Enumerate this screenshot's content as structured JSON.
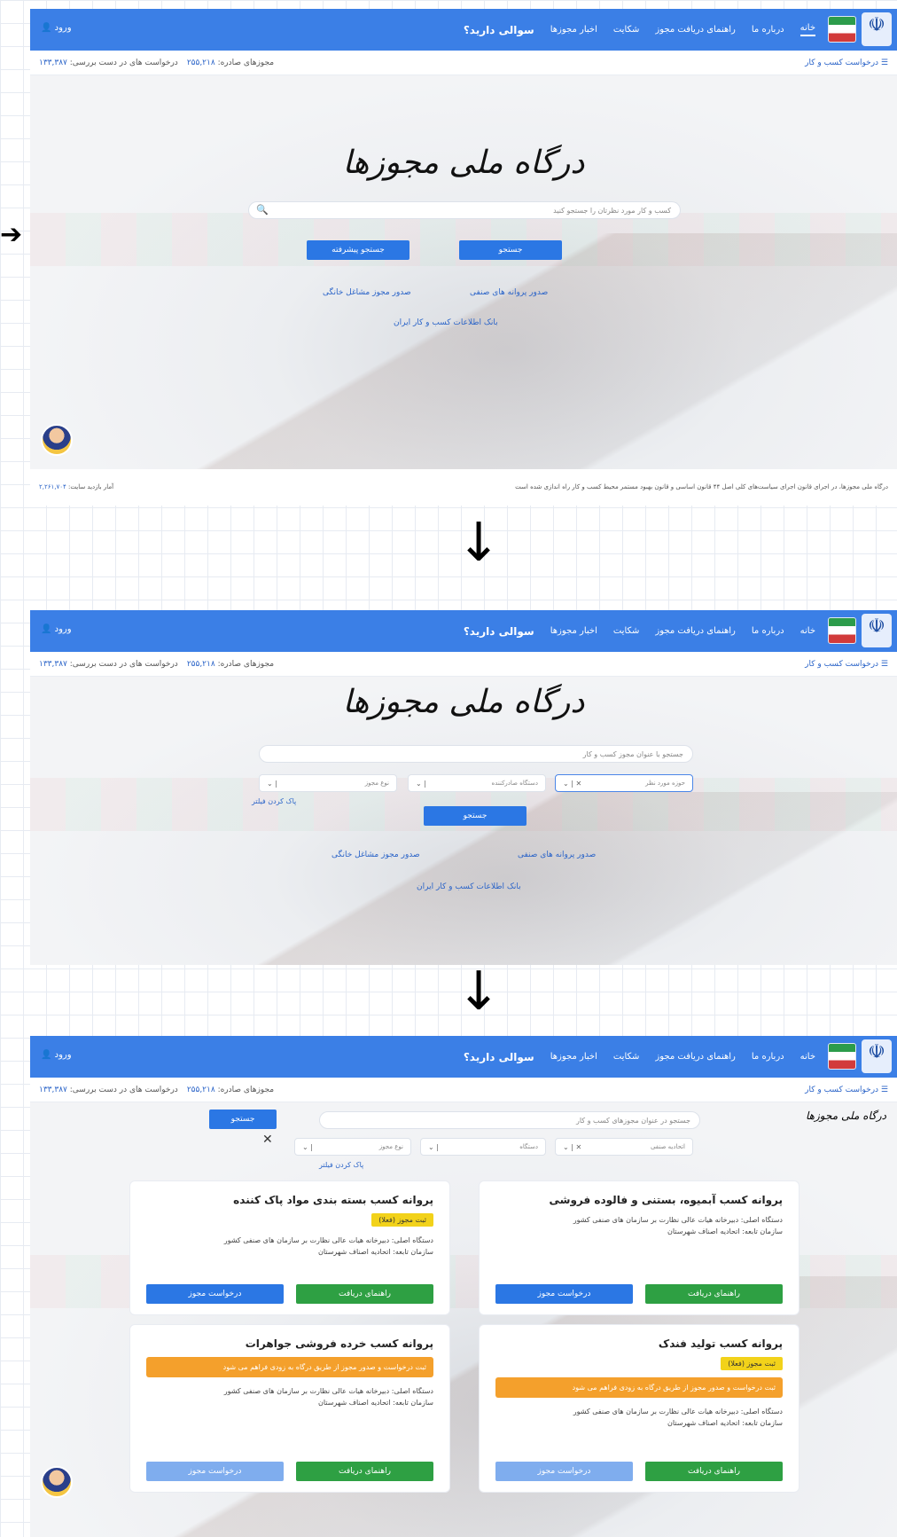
{
  "nav": {
    "login": "ورود",
    "items": [
      "خانه",
      "درباره ما",
      "راهنمای دریافت مجوز",
      "شکایت",
      "اخبار مجوزها",
      "سوالی دارید؟"
    ]
  },
  "sub": {
    "requests": "درخواست کسب و کار",
    "stats_label_requests": "درخواست های در دست بررسی:",
    "stats_value_requests": "۱۳۳,۳۸۷",
    "stats_label_issued": "مجوزهای صادره:",
    "stats_value_issued": "۲۵۵,۲۱۸"
  },
  "hero": {
    "brand": "درگاه ملی مجوزها",
    "search_placeholder": "کسب و کار مورد نظرتان را جستجو کنید",
    "search_button": "جستجو",
    "advanced_button": "جستجو پیشرفته",
    "link_industrial": "صدور پروانه های صنفی",
    "link_home": "صدور مجوز مشاغل خانگی",
    "link_bank": "بانک اطلاعات کسب و کار ایران"
  },
  "advanced": {
    "search_placeholder": "جستجو با عنوان مجوز کسب و کار",
    "select1": "حوزه مورد نظر",
    "select2": "دستگاه صادرکننده",
    "select3": "نوع مجوز",
    "clear_filters": "پاک کردن فیلتر",
    "submit": "جستجو"
  },
  "results": {
    "search_placeholder": "جستجو در عنوان مجوزهای کسب و کار",
    "select1": "اتحادیه صنفی",
    "select2": "دستگاه",
    "select3": "نوع مجوز",
    "clear_filters": "پاک کردن فیلتر",
    "submit": "جستجو",
    "request_btn": "درخواست مجوز",
    "guide_btn": "راهنمای دریافت",
    "cards": [
      {
        "title": "پروانه کسب آبمیوه، بستنی و فالوده فروشی",
        "badge": "",
        "warn": "",
        "desc": "دستگاه اصلی: دبیرخانه هیات عالی نظارت بر سازمان های صنفی کشور\nسازمان تابعه: اتحادیه اصناف شهرستان"
      },
      {
        "title": "پروانه کسب بسته بندی مواد پاک کننده",
        "badge": "ثبت مجوز (فعلا)",
        "warn": "",
        "desc": "دستگاه اصلی: دبیرخانه هیات عالی نظارت بر سازمان های صنفی کشور\nسازمان تابعه: اتحادیه اصناف شهرستان"
      },
      {
        "title": "پروانه کسب تولید فندک",
        "badge": "ثبت مجوز (فعلا)",
        "warn": "ثبت درخواست و صدور مجوز از طریق درگاه به زودی فراهم می شود",
        "desc": "دستگاه اصلی: دبیرخانه هیات عالی نظارت بر سازمان های صنفی کشور\nسازمان تابعه: اتحادیه اصناف شهرستان"
      },
      {
        "title": "پروانه کسب خرده فروشی جواهرات",
        "badge": "",
        "warn": "ثبت درخواست و صدور مجوز از طریق درگاه به زودی فراهم می شود",
        "desc": "دستگاه اصلی: دبیرخانه هیات عالی نظارت بر سازمان های صنفی کشور\nسازمان تابعه: اتحادیه اصناف شهرستان"
      }
    ]
  },
  "footer": {
    "notice": "درگاه ملی مجوزها، در اجرای قانون اجرای سیاست‌های کلی اصل ۴۴ قانون اساسی و قانون بهبود مستمر محیط کسب و کار راه اندازی شده است",
    "visits_label": "آمار بازدید سایت:",
    "visits_value": "۲,۲۶۱,۷۰۴"
  },
  "colors": {
    "nav": "#3b7fe6",
    "primary_button": "#2b77e4",
    "guide_button": "#2ea043",
    "badge": "#f2d21a",
    "warning": "#f4a02c"
  }
}
